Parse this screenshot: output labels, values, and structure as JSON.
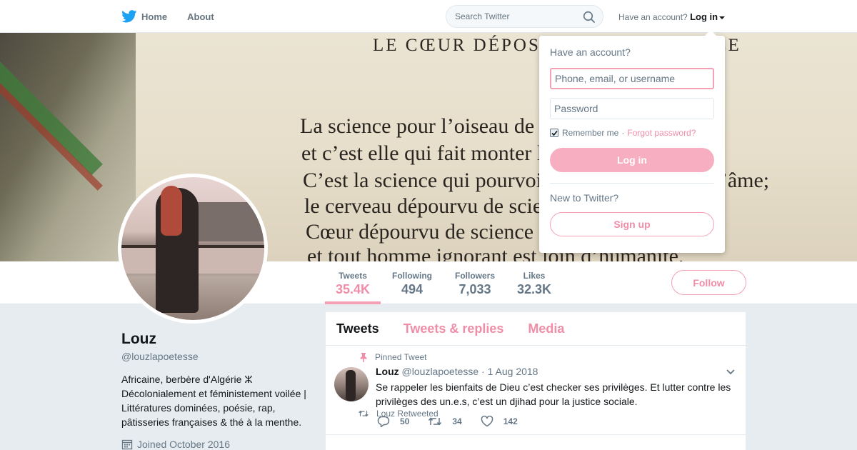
{
  "nav": {
    "home_label": "Home",
    "about_label": "About",
    "search_placeholder": "Search Twitter",
    "have_account": "Have an account?",
    "login_label": "Log in"
  },
  "banner": {
    "title": "LE CŒUR DÉPOSITAIRE DE SCIENCE",
    "lines": [
      "La science pour l’oiseau de l’âme est l’aile;",
      "et c’est elle qui fait monter l’homme.",
      "C’est la science qui pourvoit d’ailes l’oiseau de l’âme;",
      "le cerveau dépourvu de science est vide.",
      "Cœur dépourvu de science est miroir sans clarté;",
      "et tout homme ignorant est loin d’humanité."
    ]
  },
  "stats": {
    "tweets_label": "Tweets",
    "tweets_value": "35.4K",
    "following_label": "Following",
    "following_value": "494",
    "followers_label": "Followers",
    "followers_value": "7,033",
    "likes_label": "Likes",
    "likes_value": "32.3K",
    "follow_button": "Follow"
  },
  "profile": {
    "name": "Louz",
    "handle": "@louzlapoetesse",
    "bio_lines": [
      "Africaine, berbère d'Algérie ⵣ",
      "Décolonialement et féministement voilée |",
      "Littératures dominées, poésie, rap,",
      "pâtisseries françaises & thé à la menthe."
    ],
    "joined": "Joined October 2016"
  },
  "timeline": {
    "tabs": [
      "Tweets",
      "Tweets & replies",
      "Media"
    ],
    "pinned_label": "Pinned Tweet",
    "tweet": {
      "fullname": "Louz",
      "handle": "@louzlapoetesse",
      "separator": "·",
      "date": "1 Aug 2018",
      "text": "Se rappeler les bienfaits de Dieu c’est checker ses privilèges. Et lutter contre les privilèges des un.e.s, c’est un djihad pour la justice sociale.",
      "replies": "50",
      "retweets": "34",
      "likes": "142"
    },
    "retweeted_label": "Louz Retweeted"
  },
  "login_dropdown": {
    "title": "Have an account?",
    "username_placeholder": "Phone, email, or username",
    "password_placeholder": "Password",
    "remember_me": "Remember me",
    "separator": "·",
    "forgot_password": "Forgot password?",
    "login_button": "Log in",
    "new_to_twitter": "New to Twitter?",
    "signup_button": "Sign up"
  },
  "colors": {
    "accent": "#f08da8",
    "accent_border": "#f4a1b5",
    "twitter_blue": "#1da1f2",
    "muted_text": "#657786"
  }
}
